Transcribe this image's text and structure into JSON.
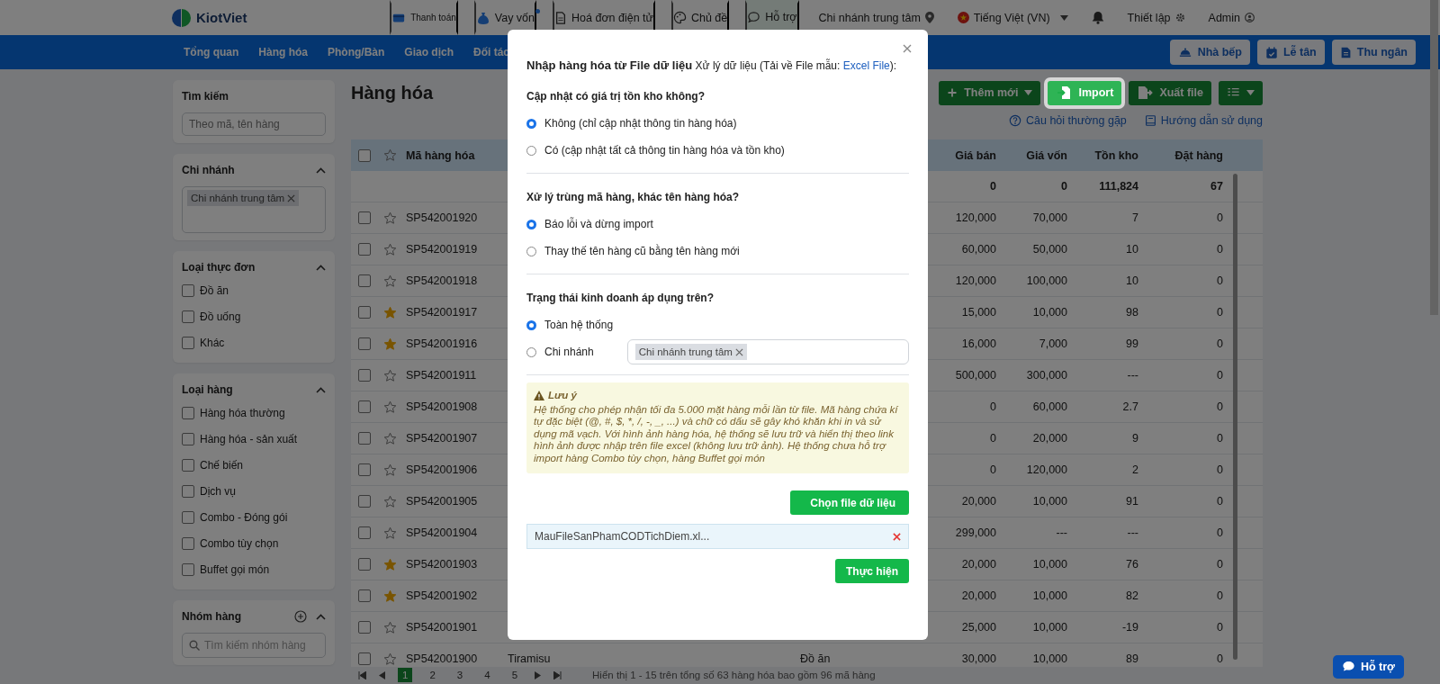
{
  "top_bar": {
    "logo": "KiotViet",
    "links": [
      {
        "label": "Thanh toán",
        "kind": "payment",
        "selected": false,
        "dot": false
      },
      {
        "label": "Vay vốn",
        "kind": "loan",
        "selected": false,
        "dot": true
      },
      {
        "label": "Hoá đơn điện tử",
        "kind": "invoice",
        "selected": false,
        "dot": false
      },
      {
        "label": "Chủ đề",
        "kind": "theme",
        "selected": false,
        "dot": false
      },
      {
        "label": "Hỗ trợ",
        "kind": "support",
        "selected": true,
        "dot": false
      }
    ],
    "branch": "Chi nhánh trung tâm",
    "language": "Tiếng Việt (VN)",
    "settings": "Thiết lập",
    "user": "Admin"
  },
  "nav": {
    "items": [
      "Tổng quan",
      "Hàng hóa",
      "Phòng/Bàn",
      "Giao dịch",
      "Đối tác"
    ],
    "buttons": [
      {
        "label": "Nhà bếp",
        "kind": "kitchen"
      },
      {
        "label": "Lễ tân",
        "kind": "reception"
      },
      {
        "label": "Thu ngân",
        "kind": "cashier"
      }
    ]
  },
  "sidebar": {
    "search": {
      "title": "Tìm kiếm",
      "placeholder": "Theo mã, tên hàng"
    },
    "branch": {
      "title": "Chi nhánh",
      "expanded": true,
      "tags": [
        "Chi nhánh trung tâm"
      ]
    },
    "filters": [
      {
        "title": "Loại thực đơn",
        "expanded": true,
        "options": [
          {
            "label": "Đồ ăn",
            "checked": false
          },
          {
            "label": "Đồ uống",
            "checked": false
          },
          {
            "label": "Khác",
            "checked": false
          }
        ]
      },
      {
        "title": "Loại hàng",
        "expanded": true,
        "options": [
          {
            "label": "Hàng hóa thường",
            "checked": false
          },
          {
            "label": "Hàng hóa - sản xuất",
            "checked": false
          },
          {
            "label": "Chế biến",
            "checked": false
          },
          {
            "label": "Dịch vụ",
            "checked": false
          },
          {
            "label": "Combo - Đóng gói",
            "checked": false
          },
          {
            "label": "Combo tùy chọn",
            "checked": false
          },
          {
            "label": "Buffet gọi món",
            "checked": false
          }
        ]
      }
    ],
    "group": {
      "title": "Nhóm hàng",
      "expanded": true,
      "placeholder": "Tìm kiếm nhóm hàng"
    }
  },
  "main": {
    "title": "Hàng hóa",
    "actions": [
      {
        "label": "Thêm mới",
        "kind": "add",
        "highlighted": false
      },
      {
        "label": "Import",
        "kind": "import",
        "highlighted": true
      },
      {
        "label": "Xuất file",
        "kind": "export",
        "highlighted": false
      },
      {
        "kind": "columns",
        "highlighted": false
      }
    ],
    "links": [
      {
        "label": "Câu hỏi thường gặp",
        "kind": "faq"
      },
      {
        "label": "Hướng dẫn sử dụng",
        "kind": "guide"
      }
    ]
  },
  "table": {
    "header_checked": false,
    "columns": {
      "code": "Mã hàng hóa",
      "price": "Giá bán",
      "cost": "Giá vốn",
      "stock": "Tồn kho",
      "ordered": "Đặt hàng"
    },
    "totals": {
      "price": "0",
      "cost": "0",
      "stock": "111,824",
      "ordered": "67"
    },
    "rows": [
      {
        "code": "SP542001920",
        "starred": false,
        "checked": false,
        "price": "120,000",
        "cost": "70,000",
        "stock": "7",
        "ordered": "0"
      },
      {
        "code": "SP542001919",
        "starred": false,
        "checked": false,
        "price": "60,000",
        "cost": "50,000",
        "stock": "10",
        "ordered": "0"
      },
      {
        "code": "SP542001918",
        "starred": false,
        "checked": false,
        "price": "120,000",
        "cost": "100,000",
        "stock": "10",
        "ordered": "0"
      },
      {
        "code": "SP542001917",
        "starred": true,
        "checked": false,
        "price": "15,000",
        "cost": "10,000",
        "stock": "98",
        "ordered": "0"
      },
      {
        "code": "SP542001916",
        "starred": true,
        "checked": false,
        "price": "16,000",
        "cost": "7,000",
        "stock": "99",
        "ordered": "0"
      },
      {
        "code": "SP542001911",
        "starred": false,
        "checked": false,
        "price": "500,000",
        "cost": "300,000",
        "stock": "---",
        "ordered": "0"
      },
      {
        "code": "SP542001908",
        "starred": false,
        "checked": false,
        "price": "0",
        "cost": "60,000",
        "stock": "2.7",
        "ordered": "0"
      },
      {
        "code": "SP542001907",
        "starred": false,
        "checked": false,
        "price": "0",
        "cost": "20,000",
        "stock": "9",
        "ordered": "0"
      },
      {
        "code": "SP542001906",
        "starred": false,
        "checked": false,
        "price": "0",
        "cost": "120,000",
        "stock": "2",
        "ordered": "0"
      },
      {
        "code": "SP542001905",
        "starred": false,
        "checked": false,
        "price": "20,000",
        "cost": "10,000",
        "stock": "91",
        "ordered": "0"
      },
      {
        "code": "SP542001904",
        "starred": false,
        "checked": false,
        "price": "299,000",
        "cost": "---",
        "stock": "---",
        "ordered": "0"
      },
      {
        "code": "SP542001903",
        "starred": true,
        "checked": false,
        "price": "20,000",
        "cost": "10,000",
        "stock": "76",
        "ordered": "0"
      },
      {
        "code": "SP542001902",
        "starred": true,
        "checked": false,
        "price": "20,000",
        "cost": "10,000",
        "stock": "82",
        "ordered": "0"
      },
      {
        "code": "SP542001901",
        "starred": false,
        "checked": false,
        "price": "25,000",
        "cost": "10,000",
        "stock": "-19",
        "ordered": "0"
      },
      {
        "code": "SP542001900",
        "starred": false,
        "checked": false,
        "name": "Tiramisu",
        "menu_type": "Đồ ăn",
        "price": "30,000",
        "cost": "10,000",
        "stock": "89",
        "ordered": "0"
      }
    ]
  },
  "pagination": {
    "pages": [
      {
        "label": "1",
        "selected": true
      },
      {
        "label": "2",
        "selected": false
      },
      {
        "label": "3",
        "selected": false
      },
      {
        "label": "4",
        "selected": false
      },
      {
        "label": "5",
        "selected": false
      }
    ],
    "summary": "Hiển thị 1 - 15 trên tổng số 63 hàng hóa bao gồm 96 mã hàng"
  },
  "support_button": "Hỗ trợ",
  "modal": {
    "title": "Nhập hàng hóa từ File dữ liệu",
    "hint": "Xử lý dữ liệu (Tải về File mẫu: ",
    "link": "Excel File",
    "hint_end": "):",
    "sections": [
      {
        "heading": "Cập nhật có giá trị tồn kho không?",
        "options": [
          {
            "label": "Không (chỉ cập nhật thông tin hàng hóa)",
            "selected": true,
            "kind": "plain"
          },
          {
            "label": "Có (cập nhật tất cả thông tin hàng hóa và tồn kho)",
            "selected": false,
            "kind": "plain"
          }
        ]
      },
      {
        "heading": "Xử lý trùng mã hàng, khác tên hàng hóa?",
        "options": [
          {
            "label": "Báo lỗi và dừng import",
            "selected": true,
            "kind": "plain"
          },
          {
            "label": "Thay thế tên hàng cũ bằng tên hàng mới",
            "selected": false,
            "kind": "plain"
          }
        ]
      },
      {
        "heading": "Trạng thái kinh doanh áp dụng trên?",
        "options": [
          {
            "label": "Toàn hệ thống",
            "selected": true,
            "kind": "plain"
          },
          {
            "label": "Chi nhánh",
            "selected": false,
            "kind": "branch",
            "tags": [
              "Chi nhánh trung tâm"
            ]
          }
        ]
      }
    ],
    "note": {
      "title": "Lưu ý",
      "text": "Hệ thống cho phép nhận tối đa 5.000 mặt hàng mỗi lần từ file. Mã hàng chứa kí tự đặc biệt (@, #, $, *, /, -, _, ...) và chữ có dấu sẽ gây khó khăn khi in và sử dụng mã vạch. Với hình ảnh hàng hóa, hệ thống sẽ lưu trữ và hiển thị theo link hình ảnh được nhập trên file excel (không lưu trữ ảnh). Hệ thống chưa hỗ trợ import hàng Combo tùy chọn, hàng Buffet gọi món"
    },
    "choose_button": "Chọn file dữ liệu",
    "file_name": "MauFileSanPhamCODTichDiem.xl...",
    "submit_button": "Thực hiện"
  }
}
